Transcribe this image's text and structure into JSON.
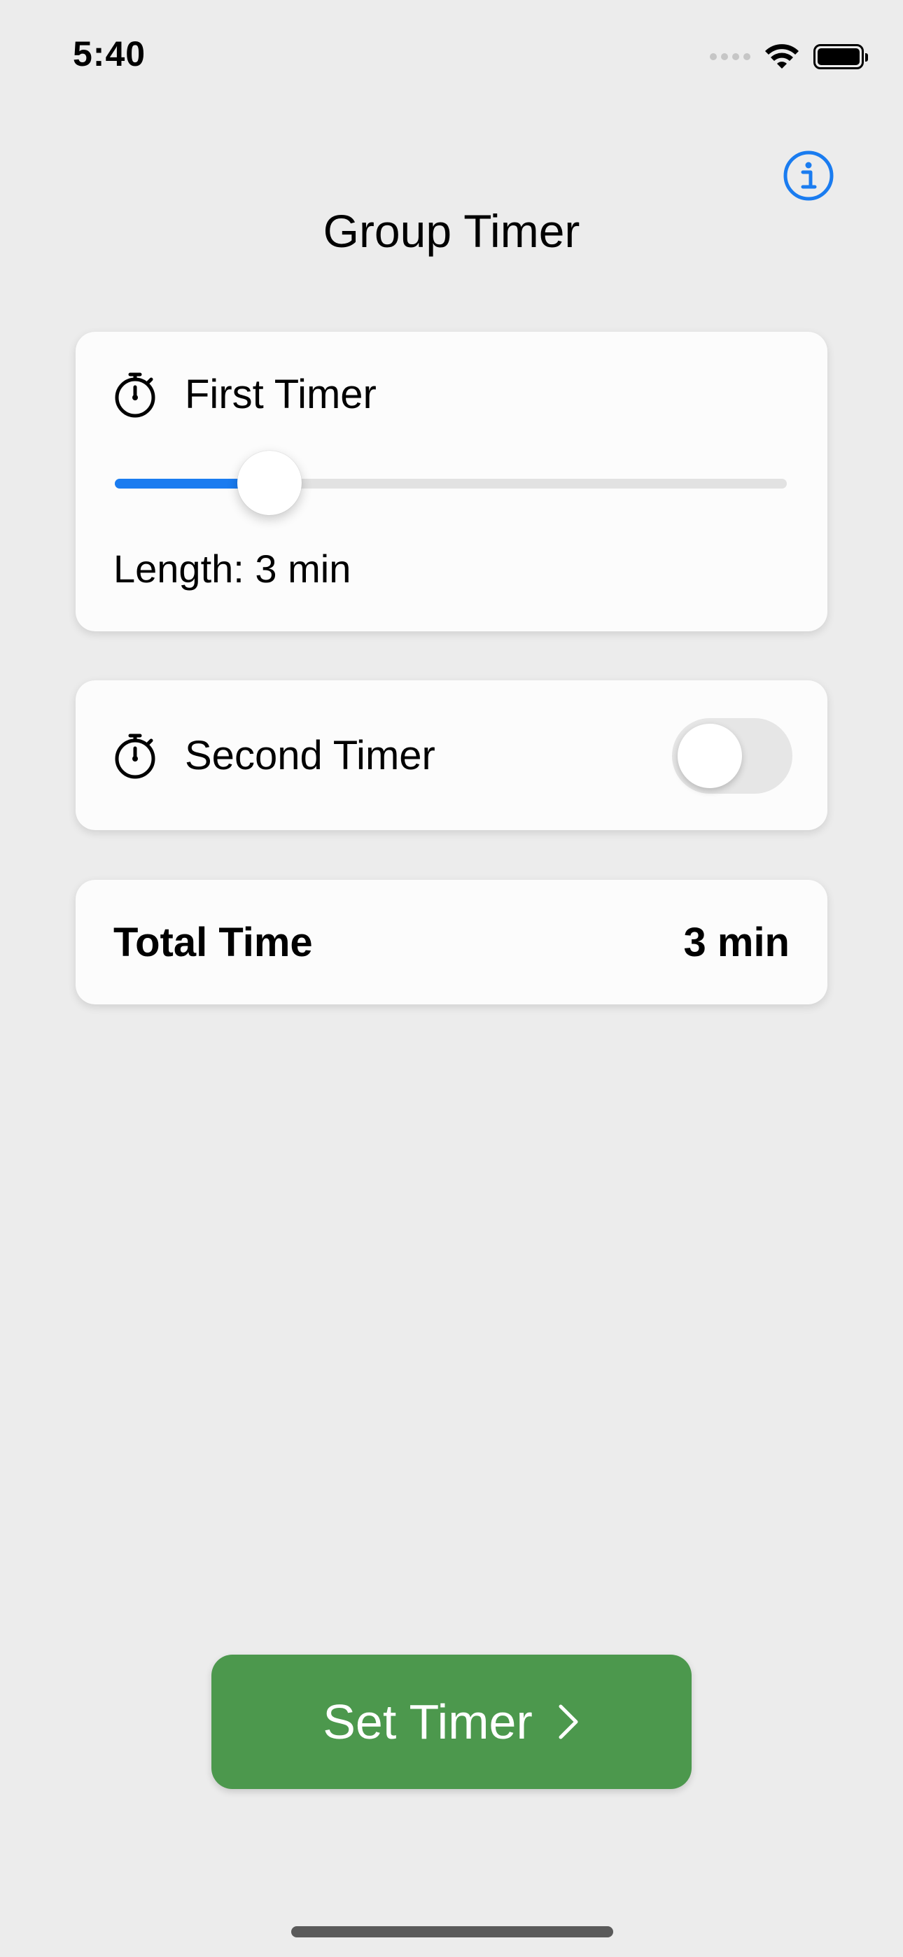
{
  "status_bar": {
    "time": "5:40"
  },
  "header": {
    "title": "Group Timer",
    "info_icon": "info-circle-icon"
  },
  "first_timer": {
    "title": "First Timer",
    "icon": "stopwatch-icon",
    "slider_fraction": 0.23,
    "length_label": "Length: 3 min"
  },
  "second_timer": {
    "title": "Second Timer",
    "icon": "stopwatch-icon",
    "enabled": false
  },
  "total": {
    "label": "Total Time",
    "value": "3 min"
  },
  "action": {
    "label": "Set Timer",
    "icon": "chevron-right-icon"
  },
  "colors": {
    "accent": "#1a7cf0",
    "button": "#4c984d",
    "background": "#ececec"
  }
}
